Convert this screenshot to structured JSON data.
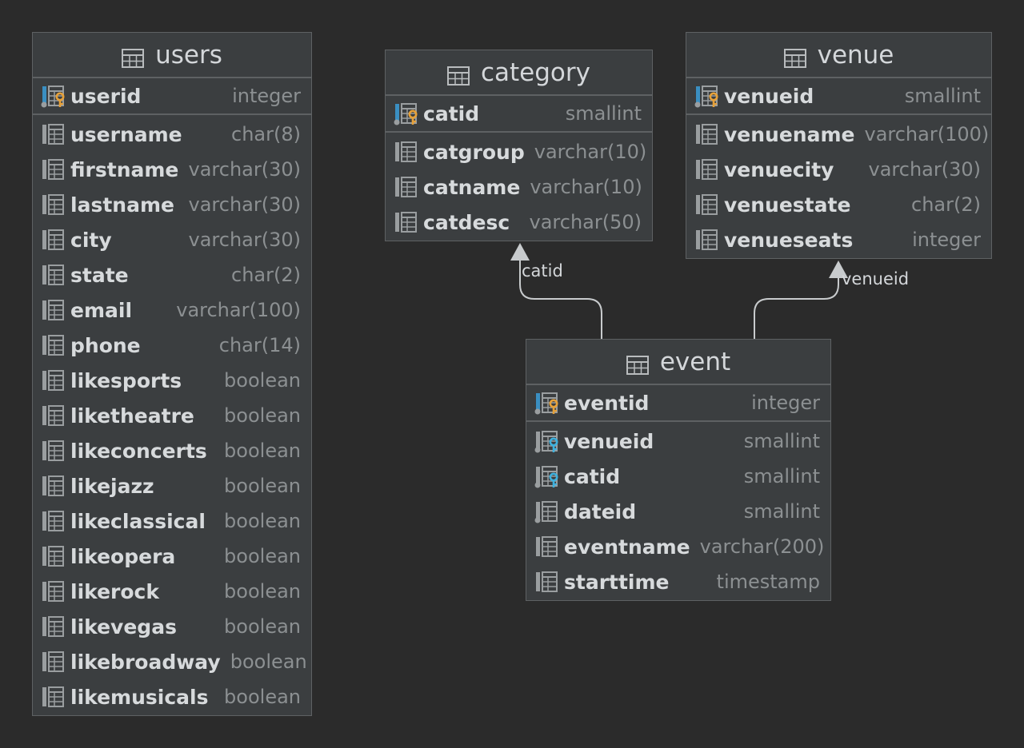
{
  "colors": {
    "background": "#2b2b2b",
    "table_bg": "#3b3e40",
    "border": "#5e6163",
    "primary_key": "#e6a13a",
    "foreign_key": "#3fb0dc",
    "edge": "#c8cbcd"
  },
  "tables": {
    "users": {
      "name": "users",
      "pk": {
        "name": "userid",
        "type": "integer"
      },
      "columns": [
        {
          "name": "username",
          "type": "char(8)"
        },
        {
          "name": "firstname",
          "type": "varchar(30)"
        },
        {
          "name": "lastname",
          "type": "varchar(30)"
        },
        {
          "name": "city",
          "type": "varchar(30)"
        },
        {
          "name": "state",
          "type": "char(2)"
        },
        {
          "name": "email",
          "type": "varchar(100)"
        },
        {
          "name": "phone",
          "type": "char(14)"
        },
        {
          "name": "likesports",
          "type": "boolean"
        },
        {
          "name": "liketheatre",
          "type": "boolean"
        },
        {
          "name": "likeconcerts",
          "type": "boolean"
        },
        {
          "name": "likejazz",
          "type": "boolean"
        },
        {
          "name": "likeclassical",
          "type": "boolean"
        },
        {
          "name": "likeopera",
          "type": "boolean"
        },
        {
          "name": "likerock",
          "type": "boolean"
        },
        {
          "name": "likevegas",
          "type": "boolean"
        },
        {
          "name": "likebroadway",
          "type": "boolean"
        },
        {
          "name": "likemusicals",
          "type": "boolean"
        }
      ]
    },
    "category": {
      "name": "category",
      "pk": {
        "name": "catid",
        "type": "smallint"
      },
      "columns": [
        {
          "name": "catgroup",
          "type": "varchar(10)"
        },
        {
          "name": "catname",
          "type": "varchar(10)"
        },
        {
          "name": "catdesc",
          "type": "varchar(50)"
        }
      ]
    },
    "venue": {
      "name": "venue",
      "pk": {
        "name": "venueid",
        "type": "smallint"
      },
      "columns": [
        {
          "name": "venuename",
          "type": "varchar(100)"
        },
        {
          "name": "venuecity",
          "type": "varchar(30)"
        },
        {
          "name": "venuestate",
          "type": "char(2)"
        },
        {
          "name": "venueseats",
          "type": "integer"
        }
      ]
    },
    "event": {
      "name": "event",
      "pk": {
        "name": "eventid",
        "type": "integer"
      },
      "columns": [
        {
          "name": "venueid",
          "type": "smallint",
          "kind": "fk"
        },
        {
          "name": "catid",
          "type": "smallint",
          "kind": "fk"
        },
        {
          "name": "dateid",
          "type": "smallint",
          "kind": "idx"
        },
        {
          "name": "eventname",
          "type": "varchar(200)"
        },
        {
          "name": "starttime",
          "type": "timestamp"
        }
      ]
    }
  },
  "edges": [
    {
      "from": "event",
      "to": "category",
      "label": "catid"
    },
    {
      "from": "event",
      "to": "venue",
      "label": "venueid"
    }
  ]
}
